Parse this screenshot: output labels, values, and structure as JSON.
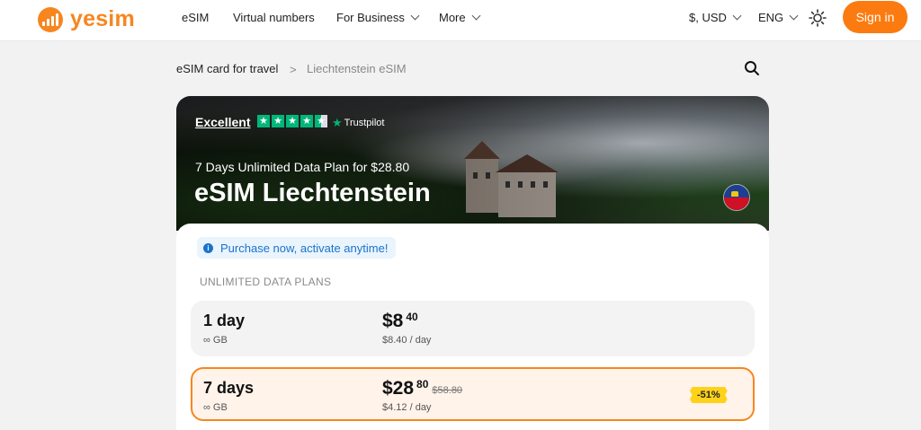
{
  "header": {
    "logo_text": "yesim",
    "nav": [
      "eSIM",
      "Virtual numbers",
      "For Business",
      "More"
    ],
    "currency": "$, USD",
    "language": "ENG",
    "theme_icon": "sun-icon",
    "signin_label": "Sign in",
    "accent_color": "#f6861f"
  },
  "breadcrumb": {
    "root": "eSIM card for travel",
    "separator": ">",
    "current": "Liechtenstein eSIM",
    "search_icon": "search-icon"
  },
  "hero": {
    "rating_label": "Excellent",
    "rating_stars": 4.5,
    "rating_provider": "Trustpilot",
    "subtitle": "7 Days Unlimited Data Plan for $28.80",
    "title": "eSIM Liechtenstein",
    "flag_icon": "liechtenstein-flag-icon"
  },
  "card": {
    "notice": "Purchase now, activate anytime!",
    "section_label": "UNLIMITED DATA PLANS",
    "plans": [
      {
        "days": "1 day",
        "data": "∞ GB",
        "price_main": "$8",
        "price_cents": "40",
        "old_price": "",
        "per_day": "$8.40 / day",
        "discount": ""
      },
      {
        "days": "7 days",
        "data": "∞ GB",
        "price_main": "$28",
        "price_cents": "80",
        "old_price": "$58.80",
        "per_day": "$4.12 / day",
        "discount": "-51%"
      }
    ]
  }
}
